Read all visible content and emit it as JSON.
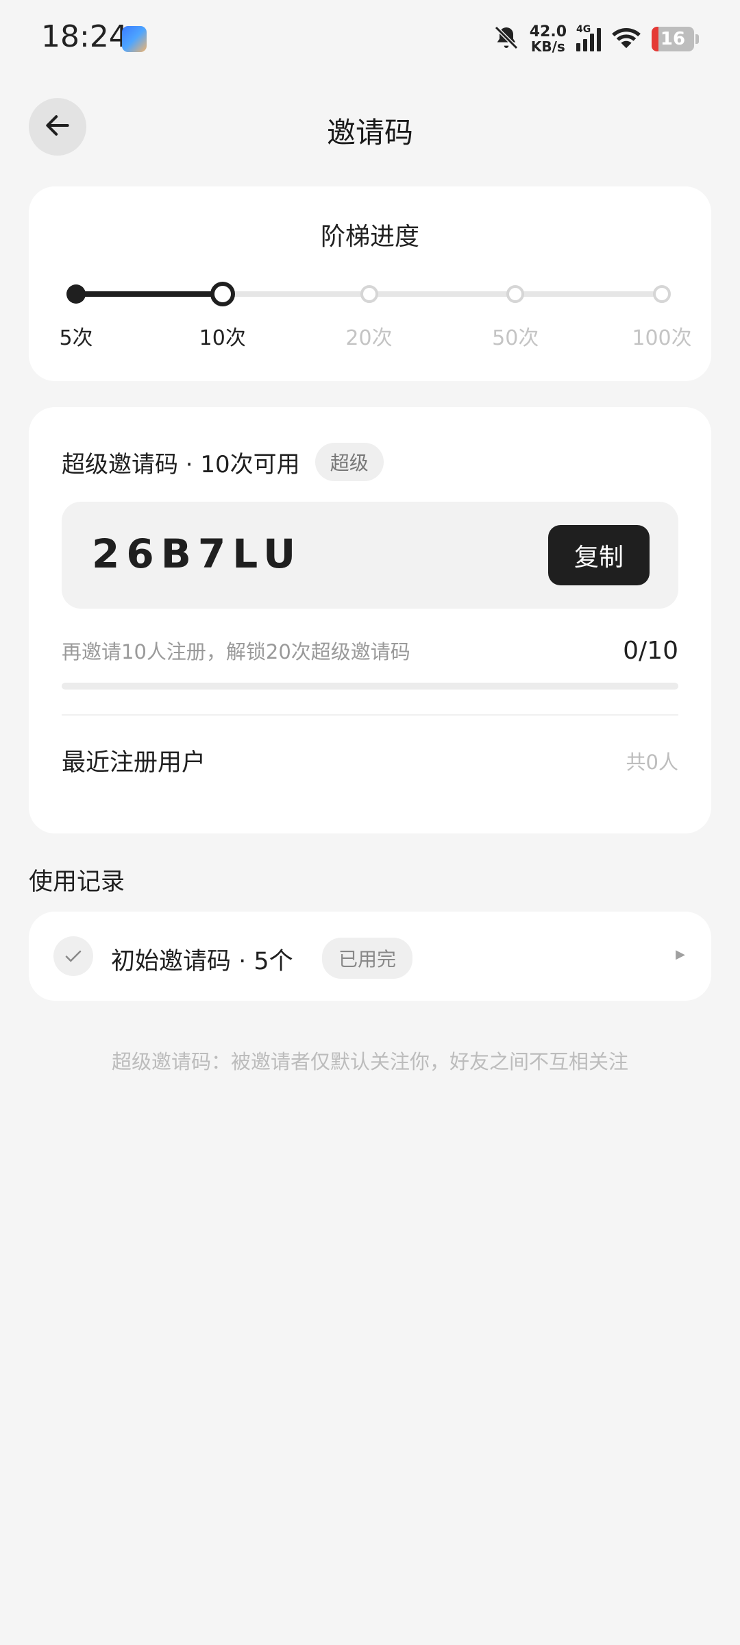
{
  "status_bar": {
    "time": "18:24",
    "net_speed_value": "42.0",
    "net_speed_unit": "KB/s",
    "network_type": "4G",
    "battery_level": "16",
    "icons": [
      "app-notification-icon",
      "bell-muted-icon",
      "cellular-signal-icon",
      "wifi-icon",
      "battery-icon"
    ]
  },
  "header": {
    "back_icon": "arrow-left-icon",
    "title": "邀请码"
  },
  "ladder": {
    "title": "阶梯进度",
    "steps": [
      {
        "label": "5次",
        "state": "done"
      },
      {
        "label": "10次",
        "state": "current"
      },
      {
        "label": "20次",
        "state": "todo"
      },
      {
        "label": "50次",
        "state": "todo"
      },
      {
        "label": "100次",
        "state": "todo"
      }
    ],
    "current_index": 1
  },
  "code_card": {
    "heading": "超级邀请码 · 10次可用",
    "badge": "超级",
    "code": "26B7LU",
    "copy_label": "复制",
    "hint": "再邀请10人注册，解锁20次超级邀请码",
    "count_text": "0/10",
    "progress_fraction": 0,
    "recent_title": "最近注册用户",
    "recent_count": "共0人"
  },
  "records": {
    "section_title": "使用记录",
    "items": [
      {
        "text": "初始邀请码 · 5个",
        "badge": "已用完"
      }
    ]
  },
  "footnote": "超级邀请码：被邀请者仅默认关注你，好友之间不互相关注",
  "colors": {
    "background": "#f5f5f5",
    "card": "#ffffff",
    "accent": "#1f1f1f",
    "muted": "#c4c4c4"
  }
}
